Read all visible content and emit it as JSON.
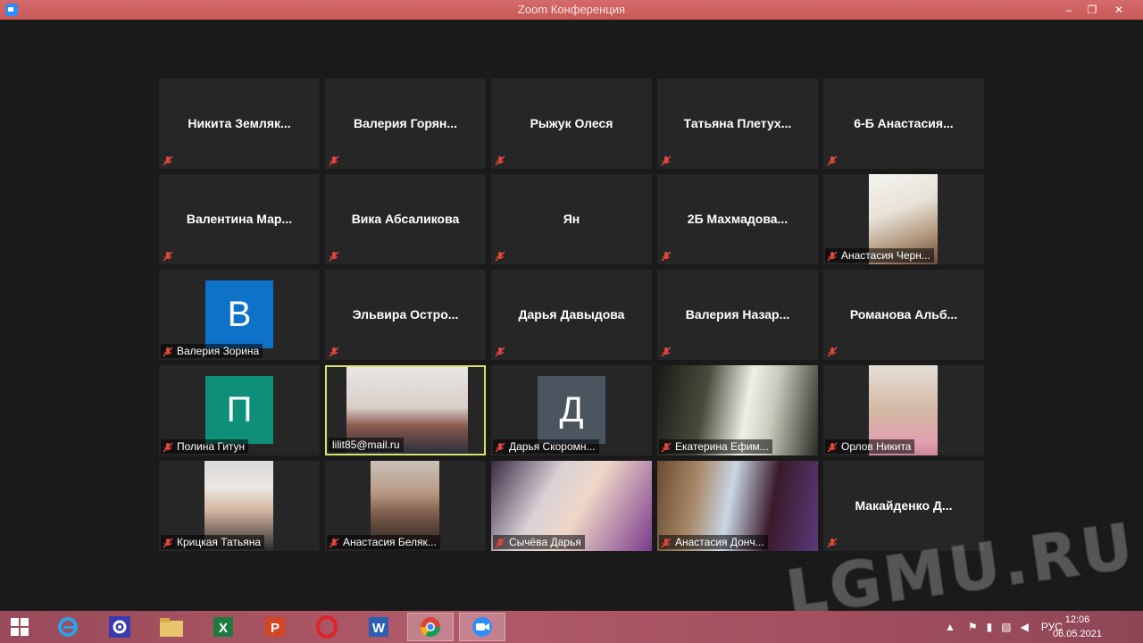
{
  "window": {
    "title": "Zoom Конференция"
  },
  "participants": [
    {
      "name": "Никита  Земляк...",
      "type": "name",
      "muted": true
    },
    {
      "name": "Валерия  Горян...",
      "type": "name",
      "muted": true
    },
    {
      "name": "Рыжук Олеся",
      "type": "name",
      "muted": true
    },
    {
      "name": "Татьяна  Плетух...",
      "type": "name",
      "muted": true
    },
    {
      "name": "6-Б  Анастасия...",
      "type": "name",
      "muted": true
    },
    {
      "name": "Валентина  Мар...",
      "type": "name",
      "muted": true
    },
    {
      "name": "Вика Абсаликова",
      "type": "name",
      "muted": true
    },
    {
      "name": "Ян",
      "type": "name",
      "muted": true
    },
    {
      "name": "2Б  Махмадова...",
      "type": "name",
      "muted": true
    },
    {
      "name": "Анастасия Черн...",
      "type": "video",
      "muted": true
    },
    {
      "name": "Валерия Зорина",
      "type": "avatar",
      "letter": "В",
      "color": "#0e72c9",
      "muted": true
    },
    {
      "name": "Эльвира  Остро...",
      "type": "name",
      "muted": true
    },
    {
      "name": "Дарья Давыдова",
      "type": "name",
      "muted": true
    },
    {
      "name": "Валерия  Назар...",
      "type": "name",
      "muted": true
    },
    {
      "name": "Романова  Альб...",
      "type": "name",
      "muted": true
    },
    {
      "name": "Полина Гитун",
      "type": "avatar",
      "letter": "П",
      "color": "#0e8f7a",
      "muted": true
    },
    {
      "name": "lilit85@mail.ru",
      "type": "video",
      "muted": false,
      "active": true
    },
    {
      "name": "Дарья Скоромн...",
      "type": "avatar",
      "letter": "Д",
      "color": "#4a5560",
      "muted": true
    },
    {
      "name": "Екатерина Ефим...",
      "type": "video",
      "muted": true
    },
    {
      "name": "Орлов Никита",
      "type": "video",
      "muted": true
    },
    {
      "name": "Крицкая Татьяна",
      "type": "video",
      "muted": true
    },
    {
      "name": "Анастасия Беляк...",
      "type": "video",
      "muted": true
    },
    {
      "name": "Сычёва Дарья",
      "type": "video",
      "muted": true
    },
    {
      "name": "Анастасия Донч...",
      "type": "video",
      "muted": true
    },
    {
      "name": "Макайденко  Д...",
      "type": "name",
      "muted": true
    }
  ],
  "watermark": "LGMU.RU",
  "taskbar": {
    "tray_language": "РУС",
    "time": "12:06",
    "date": "06.05.2021"
  },
  "colors": {
    "titlebar": "#c85858",
    "tile_bg": "#262626",
    "active_border": "#d9e16a",
    "mute_icon": "#e0463b"
  }
}
